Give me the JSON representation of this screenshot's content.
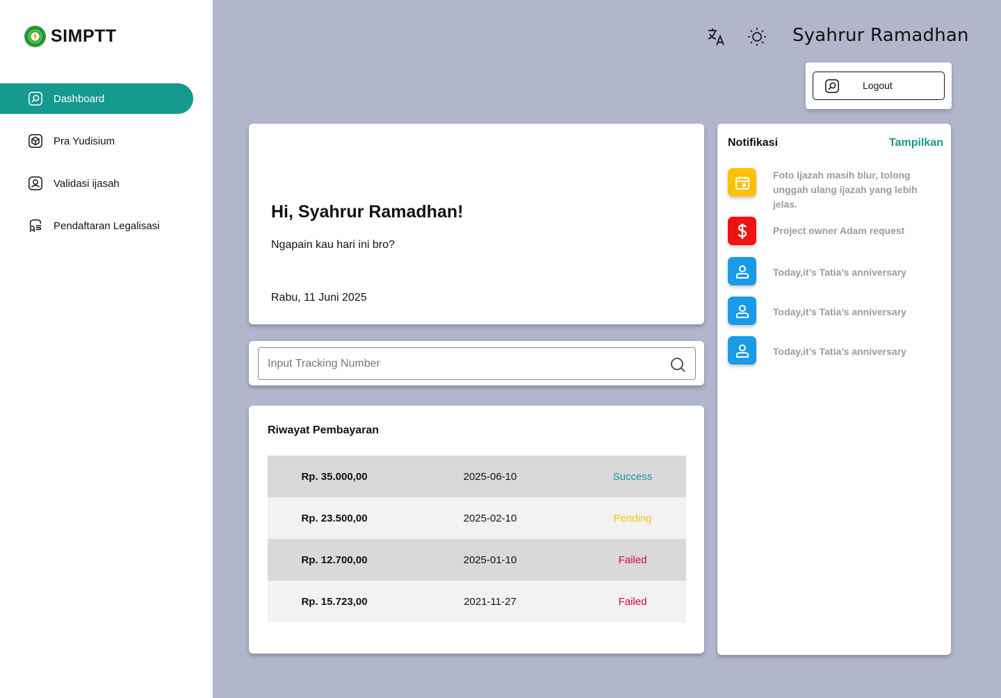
{
  "app": {
    "name": "SIMPTT"
  },
  "sidebar": {
    "items": [
      {
        "label": "Dashboard",
        "icon": "dashboard-icon",
        "active": true
      },
      {
        "label": "Pra Yudisium",
        "icon": "box-icon",
        "active": false
      },
      {
        "label": "Validasi ijasah",
        "icon": "user-card-icon",
        "active": false
      },
      {
        "label": "Pendaftaran Legalisasi",
        "icon": "legalization-icon",
        "active": false
      }
    ]
  },
  "header": {
    "translate_icon": "translate-icon",
    "theme_icon": "sun-icon",
    "user_name": "Syahrur Ramadhan",
    "logout_label": "Logout"
  },
  "welcome": {
    "greeting": "Hi, Syahrur Ramadhan!",
    "subtitle": "Ngapain kau hari ini bro?",
    "date": "Rabu, 11 Juni 2025"
  },
  "search": {
    "placeholder": "Input Tracking Number",
    "value": ""
  },
  "history": {
    "title": "Riwayat Pembayaran",
    "rows": [
      {
        "amount": "Rp. 35.000,00",
        "date": "2025-06-10",
        "status": "Success",
        "status_color": "#16998e"
      },
      {
        "amount": "Rp. 23.500,00",
        "date": "2025-02-10",
        "status": "Pending",
        "status_color": "#f5c211"
      },
      {
        "amount": "Rp. 12.700,00",
        "date": "2025-01-10",
        "status": "Failed",
        "status_color": "#d6004a"
      },
      {
        "amount": "Rp. 15.723,00",
        "date": "2021-11-27",
        "status": "Failed",
        "status_color": "#d6004a"
      }
    ]
  },
  "notifications": {
    "title": "Notifikasi",
    "show_all": "Tampilkan",
    "items": [
      {
        "text": "Foto Ijazah masih blur, tolong unggah ulang ijazah yang lebih jelas.",
        "icon": "calendar-icon",
        "color": "#ffc107"
      },
      {
        "text": "Project owner Adam request",
        "icon": "dollar-icon",
        "color": "#f01313"
      },
      {
        "text": "Today,it’s Tatia’s anniversary",
        "icon": "user-icon",
        "color": "#1a9be6"
      },
      {
        "text": "Today,it’s Tatia’s anniversary",
        "icon": "user-icon",
        "color": "#1a9be6"
      },
      {
        "text": "Today,it’s Tatia’s anniversary",
        "icon": "user-icon",
        "color": "#1a9be6"
      }
    ]
  },
  "colors": {
    "accent": "#16998e",
    "background": "#b1b6cb"
  }
}
